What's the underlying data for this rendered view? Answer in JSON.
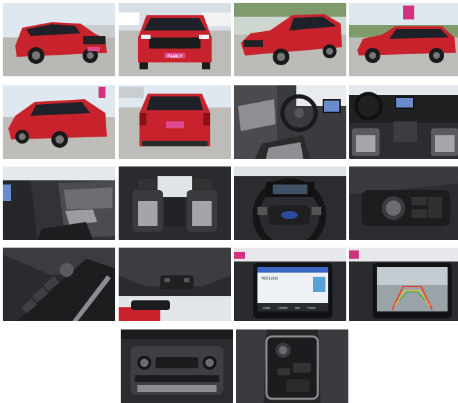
{
  "gallery": {
    "photos": [
      {
        "name": "front-three-quarter-left"
      },
      {
        "name": "front-view"
      },
      {
        "name": "front-three-quarter-right"
      },
      {
        "name": "side-profile-right"
      },
      {
        "name": "rear-three-quarter-left"
      },
      {
        "name": "rear-view"
      },
      {
        "name": "driver-cockpit"
      },
      {
        "name": "dashboard-overview"
      },
      {
        "name": "passenger-door-panel"
      },
      {
        "name": "rear-seats"
      },
      {
        "name": "steering-wheel"
      },
      {
        "name": "headlight-switch-panel"
      },
      {
        "name": "window-switch-panel"
      },
      {
        "name": "overhead-console"
      },
      {
        "name": "infotainment-screen"
      },
      {
        "name": "backup-camera-screen"
      },
      {
        "name": "climate-controls"
      },
      {
        "name": "gear-selector-console"
      }
    ],
    "plate_text": "FAMILY",
    "screen": {
      "title": "Kid Lotto",
      "nav": [
        "Audio",
        "Climate",
        "Nav",
        "Phone"
      ]
    }
  },
  "colors": {
    "car_red": "#c8232c",
    "sky": "#dfe7ef",
    "asphalt": "#bdbcb8",
    "interior_dark": "#2b2b2d",
    "interior_grey": "#8e8f92"
  }
}
